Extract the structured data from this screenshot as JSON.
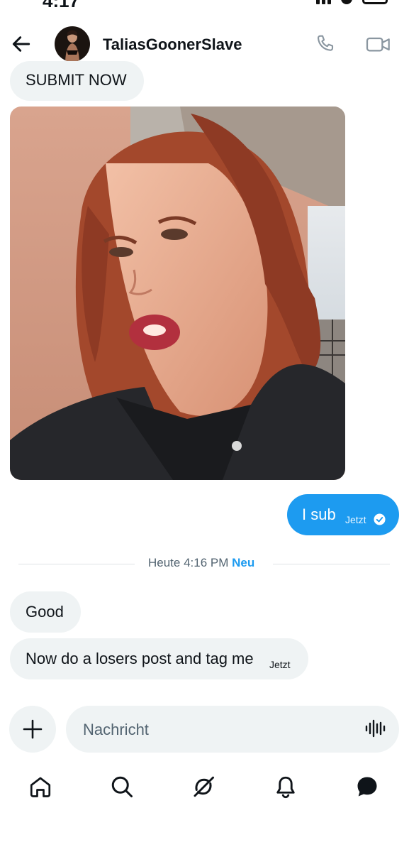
{
  "status_bar": {
    "time": "4:17"
  },
  "header": {
    "title": "TaliasGoonerSlave"
  },
  "messages": {
    "m1": {
      "text": "SUBMIT NOW"
    },
    "m2": {
      "text": "I sub",
      "time": "Jetzt"
    },
    "m3": {
      "text": "Good"
    },
    "m4": {
      "text": "Now do a losers post and tag me",
      "time": "Jetzt"
    }
  },
  "divider": {
    "label": "Heute 4:16 PM",
    "badge": "Neu"
  },
  "composer": {
    "placeholder": "Nachricht"
  },
  "icons": {
    "back": "arrow-left-icon",
    "phone": "phone-icon",
    "video": "video-icon",
    "plus": "plus-icon",
    "mic": "voice-wave-icon",
    "read": "check-circle-icon",
    "home": "home-icon",
    "search": "search-icon",
    "grok": "grok-icon",
    "notifications": "bell-icon",
    "messages": "message-icon"
  },
  "colors": {
    "accent": "#1d9bf0",
    "bubble_in": "#eff3f4",
    "text": "#0f1419",
    "muted": "#536471"
  }
}
